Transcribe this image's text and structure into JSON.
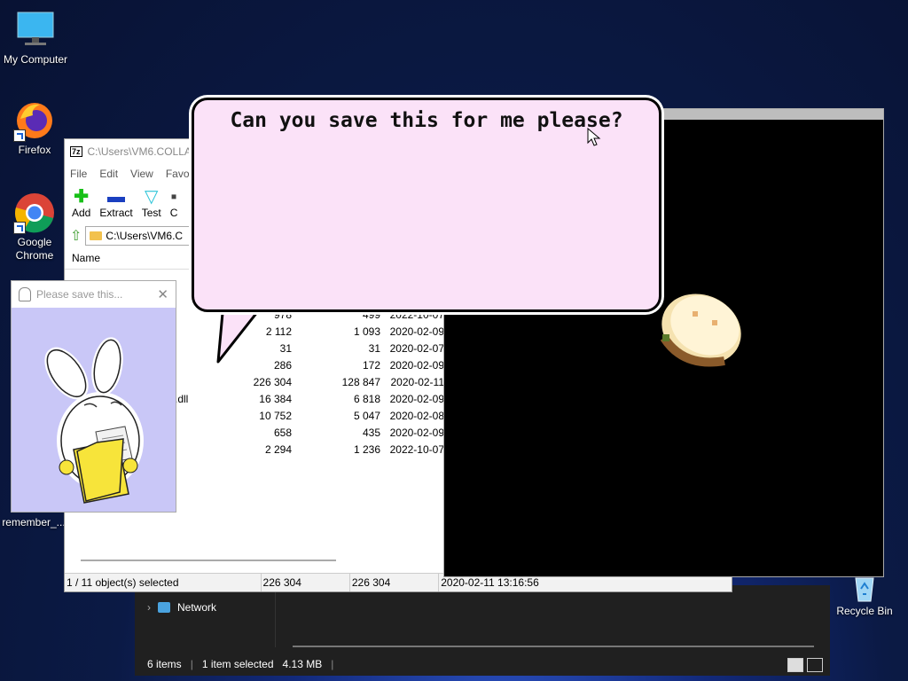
{
  "desktop": {
    "icons": [
      {
        "label": "My Computer"
      },
      {
        "label": "Firefox"
      },
      {
        "label": "Google Chrome"
      },
      {
        "label": "remember_..."
      },
      {
        "label": "Recycle Bin"
      }
    ]
  },
  "explorer": {
    "nav_network": "Network",
    "status_items": "6 items",
    "status_selected": "1 item selected",
    "status_size": "4.13 MB"
  },
  "sevenzip": {
    "title": "C:\\Users\\VM6.COLLA",
    "menu": [
      "File",
      "Edit",
      "View",
      "Favori"
    ],
    "toolbar": [
      "Add",
      "Extract",
      "Test",
      "C"
    ],
    "address": "C:\\Users\\VM6.C",
    "column_name": "Name",
    "rows": [
      {
        "name": "",
        "size": "978",
        "packed": "499",
        "date": "2022-10-07"
      },
      {
        "name": "",
        "size": "2 112",
        "packed": "1 093",
        "date": "2020-02-09"
      },
      {
        "name": "",
        "size": "31",
        "packed": "31",
        "date": "2020-02-07"
      },
      {
        "name": "",
        "size": "286",
        "packed": "172",
        "date": "2020-02-09"
      },
      {
        "name": "",
        "size": "226 304",
        "packed": "128 847",
        "date": "2020-02-11"
      },
      {
        "name": ".dll",
        "size": "16 384",
        "packed": "6 818",
        "date": "2020-02-09"
      },
      {
        "name": "",
        "size": "10 752",
        "packed": "5 047",
        "date": "2020-02-08"
      },
      {
        "name": "",
        "size": "658",
        "packed": "435",
        "date": "2020-02-09"
      },
      {
        "name": "",
        "size": "2 294",
        "packed": "1 236",
        "date": "2022-10-07"
      }
    ],
    "status": {
      "selected": "1 / 11 object(s) selected",
      "size": "226 304",
      "packed": "226 304",
      "modified": "2020-02-11 13:16:56"
    }
  },
  "popup": {
    "title": "Please save this..."
  },
  "bubble": {
    "message": "Can you save this for me please?"
  }
}
